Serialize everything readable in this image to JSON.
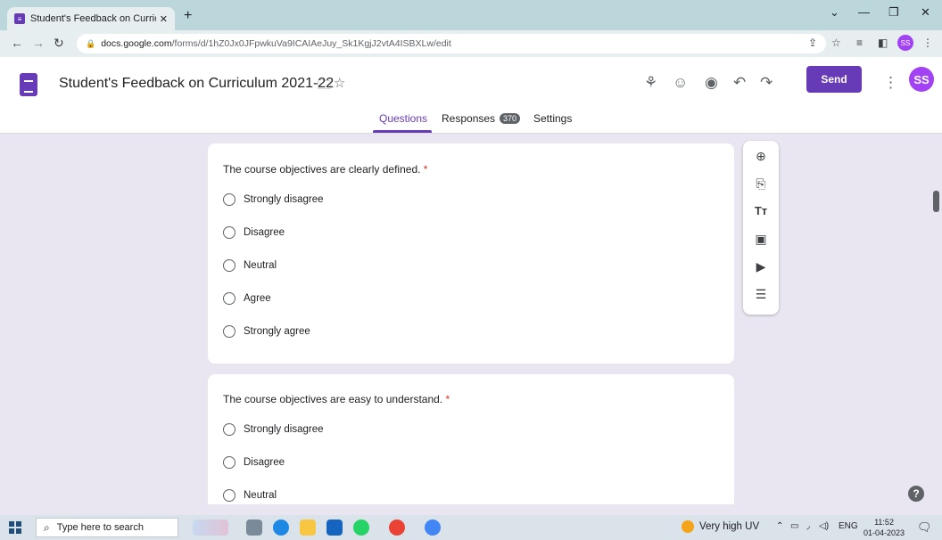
{
  "browser": {
    "tab_title": "Student's Feedback on Curriculu",
    "tab_close": "✕",
    "new_tab": "+",
    "url_domain": "docs.google.com",
    "url_path": "/forms/d/1hZ0Jx0JFpwkuVa9ICAIAeJuy_Sk1KgjJ2vtA4ISBXLw/edit",
    "profile_initials": "SS"
  },
  "form": {
    "title": "Student's Feedback on Curriculum 2021-22",
    "send_label": "Send",
    "avatar_initials": "SS",
    "tabs": [
      {
        "label": "Questions",
        "active": true
      },
      {
        "label": "Responses",
        "badge": "370"
      },
      {
        "label": "Settings"
      }
    ]
  },
  "questions": [
    {
      "text": "The course objectives are clearly defined.",
      "required_mark": "*",
      "options": [
        "Strongly disagree",
        "Disagree",
        "Neutral",
        "Agree",
        "Strongly agree"
      ]
    },
    {
      "text": "The course objectives are easy to understand.",
      "required_mark": "*",
      "options": [
        "Strongly disagree",
        "Disagree",
        "Neutral"
      ]
    }
  ],
  "sidebar_tools": [
    "add-question-icon",
    "import-questions-icon",
    "add-title-icon",
    "add-image-icon",
    "add-video-icon",
    "add-section-icon"
  ],
  "taskbar": {
    "search_placeholder": "Type here to search",
    "weather": "Very high UV",
    "language": "ENG",
    "time": "11:52",
    "date": "01-04-2023"
  },
  "colors": {
    "accent": "#673ab7",
    "background": "#e9e6f2",
    "required": "#d93025"
  }
}
